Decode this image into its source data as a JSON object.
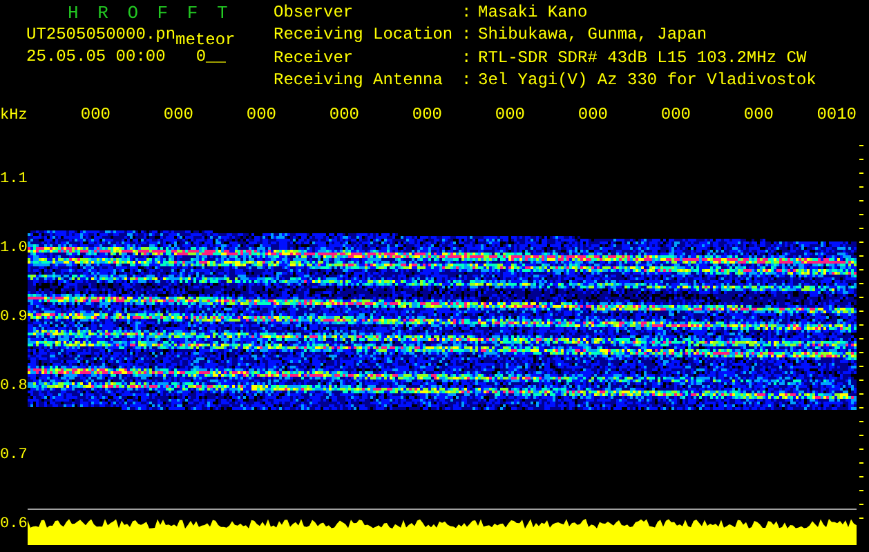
{
  "header": {
    "title": "H R O F F T",
    "file_name": "UT2505050000.pn",
    "mode": "meteor",
    "timestamp": "25.05.05 00:00",
    "count": "0__"
  },
  "station": [
    {
      "label": "Observer",
      "separator": ":",
      "value": "Masaki Kano"
    },
    {
      "label": "Receiving Location",
      "separator": ":",
      "value": "Shibukawa, Gunma, Japan"
    },
    {
      "label": "Receiver",
      "separator": ":",
      "value": "RTL-SDR SDR# 43dB L15 103.2MHz CW"
    },
    {
      "label": "Receiving Antenna",
      "separator": ":",
      "value": "3el Yagi(V) Az 330 for Vladivostok"
    }
  ],
  "y_axis": {
    "unit": "kHz",
    "labels": [
      "1.1",
      "1.0",
      "0.9",
      "0.8",
      "0.7",
      "0.6"
    ]
  },
  "x_axis": {
    "labels": [
      "000",
      "000",
      "000",
      "000",
      "000",
      "000",
      "000",
      "000",
      "000",
      "0010"
    ]
  }
}
